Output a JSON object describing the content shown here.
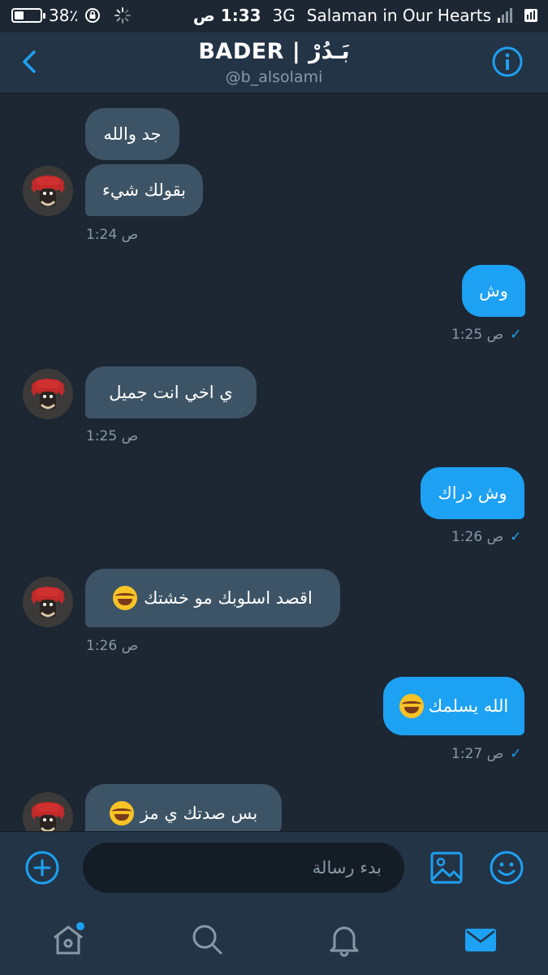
{
  "status_bar": {
    "battery": "38٪",
    "battery_level": 0.38,
    "clock": "1:33 ص",
    "network": "3G",
    "carrier": "Salaman in Our Hearts"
  },
  "header": {
    "title": "BADER | بَـدُرْ",
    "handle": "@b_alsolami"
  },
  "messages": [
    {
      "side": "received",
      "text": "جد والله"
    },
    {
      "side": "received",
      "text": "بقولك شيء",
      "time": "1:24 ص"
    },
    {
      "side": "sent",
      "text": "وش",
      "time": "1:25 ص"
    },
    {
      "side": "received",
      "text": "ي اخي انت جميل",
      "time": "1:25 ص"
    },
    {
      "side": "sent",
      "text": "وش دراك",
      "time": "1:26 ص"
    },
    {
      "side": "received",
      "text": "اقصد اسلوبك مو خشتك",
      "emoji": "face-with-tears-of-joy",
      "time": "1:26 ص"
    },
    {
      "side": "sent",
      "text": "الله يسلمك",
      "emoji": "rolling-on-the-floor-laughing",
      "time": "1:27 ص"
    },
    {
      "side": "received",
      "text": "بس صدتك ي مز",
      "emoji": "face-with-tears-of-joy"
    }
  ],
  "composer": {
    "placeholder": "بدء رسالة"
  },
  "colors": {
    "background": "#1c2733",
    "bar": "#243447",
    "accent": "#1da1f2",
    "received_bubble": "#3d5466",
    "muted": "#8899a6"
  },
  "tabs": [
    "home-icon",
    "search-icon",
    "notifications-icon",
    "messages-icon"
  ]
}
